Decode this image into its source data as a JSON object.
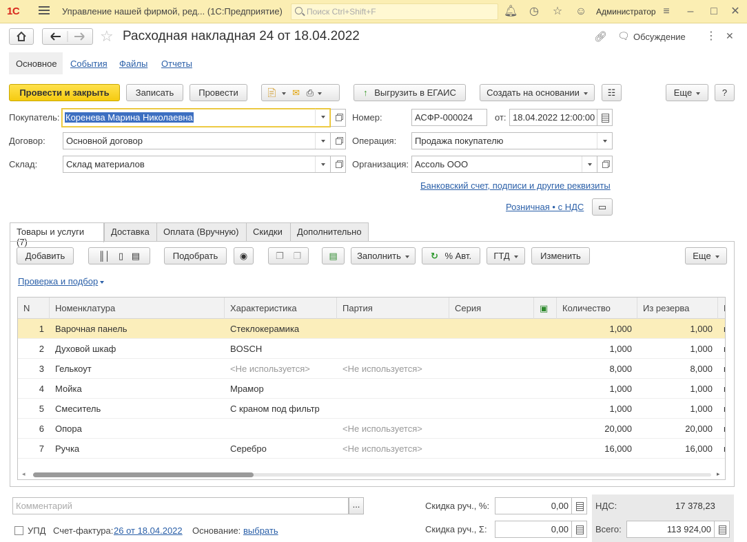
{
  "titlebar": {
    "logo": "1С",
    "app_name": "Управление нашей фирмой, ред...  (1С:Предприятие)",
    "search_placeholder": "Поиск Ctrl+Shift+F",
    "user": "Администратор"
  },
  "header": {
    "doc_title": "Расходная накладная 24 от 18.04.2022",
    "discuss": "Обсуждение"
  },
  "top_tabs": [
    {
      "label": "Основное"
    },
    {
      "label": "События"
    },
    {
      "label": "Файлы"
    },
    {
      "label": "Отчеты"
    }
  ],
  "toolbar": {
    "post_close": "Провести и закрыть",
    "save": "Записать",
    "post": "Провести",
    "egais": "Выгрузить в ЕГАИС",
    "create_based": "Создать на основании",
    "more": "Еще",
    "help": "?"
  },
  "form": {
    "buyer_label": "Покупатель:",
    "buyer_value": "Коренева Марина Николаевна",
    "contract_label": "Договор:",
    "contract_value": "Основной договор",
    "warehouse_label": "Склад:",
    "warehouse_value": "Склад материалов",
    "number_label": "Номер:",
    "number_value": "АСФР-000024",
    "from_label": "от:",
    "date_value": "18.04.2022 12:00:00",
    "operation_label": "Операция:",
    "operation_value": "Продажа покупателю",
    "org_label": "Организация:",
    "org_value": "Ассоль ООО",
    "bank_link": "Банковский счет, подписи и другие реквизиты",
    "price_link": "Розничная • с НДС"
  },
  "lower_tabs": [
    {
      "label": "Товары и услуги (7)"
    },
    {
      "label": "Доставка"
    },
    {
      "label": "Оплата (Вручную)"
    },
    {
      "label": "Скидки"
    },
    {
      "label": "Дополнительно"
    }
  ],
  "table_toolbar": {
    "add": "Добавить",
    "pick": "Подобрать",
    "fill": "Заполнить",
    "auto_pct": "% Авт.",
    "gtd": "ГТД",
    "change": "Изменить",
    "more": "Еще",
    "check_link": "Проверка и подбор"
  },
  "table": {
    "columns": [
      "N",
      "Номенклатура",
      "Характеристика",
      "Партия",
      "Серия",
      "",
      "Количество",
      "Из резерва",
      "Е"
    ],
    "rows": [
      {
        "n": "1",
        "item": "Варочная панель",
        "char": "Стеклокерамика",
        "batch": "",
        "series": "",
        "qty": "1,000",
        "reserve": "1,000",
        "unit": "ш"
      },
      {
        "n": "2",
        "item": "Духовой шкаф",
        "char": "BOSCH",
        "batch": "",
        "series": "",
        "qty": "1,000",
        "reserve": "1,000",
        "unit": "ш"
      },
      {
        "n": "3",
        "item": "Гелькоут",
        "char": "<Не используется>",
        "batch": "<Не используется>",
        "series": "",
        "qty": "8,000",
        "reserve": "8,000",
        "unit": "к"
      },
      {
        "n": "4",
        "item": "Мойка",
        "char": "Мрамор",
        "batch": "",
        "series": "",
        "qty": "1,000",
        "reserve": "1,000",
        "unit": "ш"
      },
      {
        "n": "5",
        "item": "Смеситель",
        "char": "С краном под фильтр",
        "batch": "",
        "series": "",
        "qty": "1,000",
        "reserve": "1,000",
        "unit": "ш"
      },
      {
        "n": "6",
        "item": "Опора",
        "char": "",
        "batch": "<Не используется>",
        "series": "",
        "qty": "20,000",
        "reserve": "20,000",
        "unit": "ш"
      },
      {
        "n": "7",
        "item": "Ручка",
        "char": "Серебро",
        "batch": "<Не используется>",
        "series": "",
        "qty": "16,000",
        "reserve": "16,000",
        "unit": "ш"
      }
    ]
  },
  "footer": {
    "comment_placeholder": "Комментарий",
    "discount_pct_label": "Скидка руч., %:",
    "discount_pct_value": "0,00",
    "discount_sum_label": "Скидка руч., Σ:",
    "discount_sum_value": "0,00",
    "vat_label": "НДС:",
    "vat_value": "17 378,23",
    "total_label": "Всего:",
    "total_value": "113 924,00",
    "upd_label": "УПД",
    "invoice_label": "Счет-фактура:",
    "invoice_link": "26  от 18.04.2022",
    "basis_label": "Основание:",
    "basis_link": "выбрать"
  }
}
